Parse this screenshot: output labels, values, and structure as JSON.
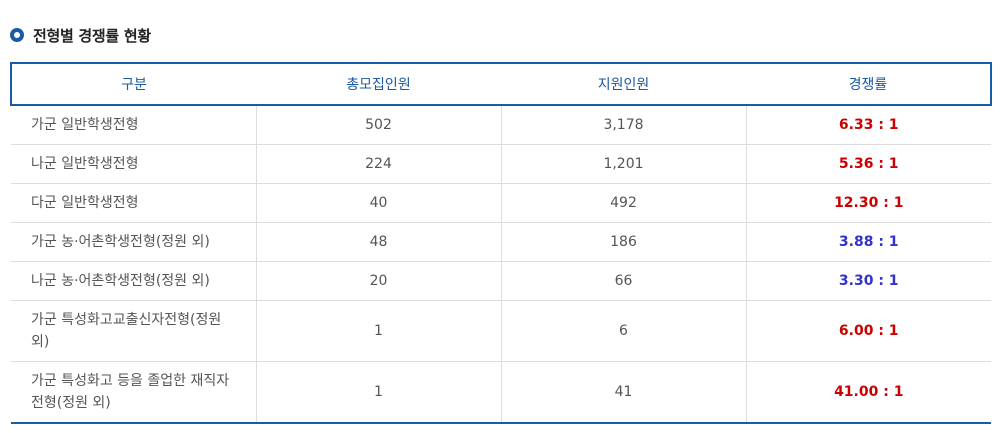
{
  "section": {
    "title": "전형별 경쟁률 현황"
  },
  "table": {
    "headers": [
      "구분",
      "총모집인원",
      "지원인원",
      "경쟁률"
    ],
    "rows": [
      {
        "category": "가군 일반학생전형",
        "quota": "502",
        "applicants": "3,178",
        "ratio": "6.33 : 1",
        "ratio_color": "#cc0000"
      },
      {
        "category": "나군 일반학생전형",
        "quota": "224",
        "applicants": "1,201",
        "ratio": "5.36 : 1",
        "ratio_color": "#cc0000"
      },
      {
        "category": "다군 일반학생전형",
        "quota": "40",
        "applicants": "492",
        "ratio": "12.30 : 1",
        "ratio_color": "#cc0000"
      },
      {
        "category": "가군 농·어촌학생전형(정원 외)",
        "quota": "48",
        "applicants": "186",
        "ratio": "3.88 : 1",
        "ratio_color": "#3333cc"
      },
      {
        "category": "나군 농·어촌학생전형(정원 외)",
        "quota": "20",
        "applicants": "66",
        "ratio": "3.30 : 1",
        "ratio_color": "#3333cc"
      },
      {
        "category": "가군 특성화고교출신자전형(정원 외)",
        "quota": "1",
        "applicants": "6",
        "ratio": "6.00 : 1",
        "ratio_color": "#cc0000"
      },
      {
        "category": "가군 특성화고 등을 졸업한 재직자전형(정원 외)",
        "quota": "1",
        "applicants": "41",
        "ratio": "41.00 : 1",
        "ratio_color": "#cc0000"
      }
    ]
  },
  "colors": {
    "accent": "#1a5aa6",
    "ratio_high": "#cc0000",
    "ratio_low": "#3333cc"
  },
  "icons": {
    "bullet": "radio-bullet-icon"
  }
}
